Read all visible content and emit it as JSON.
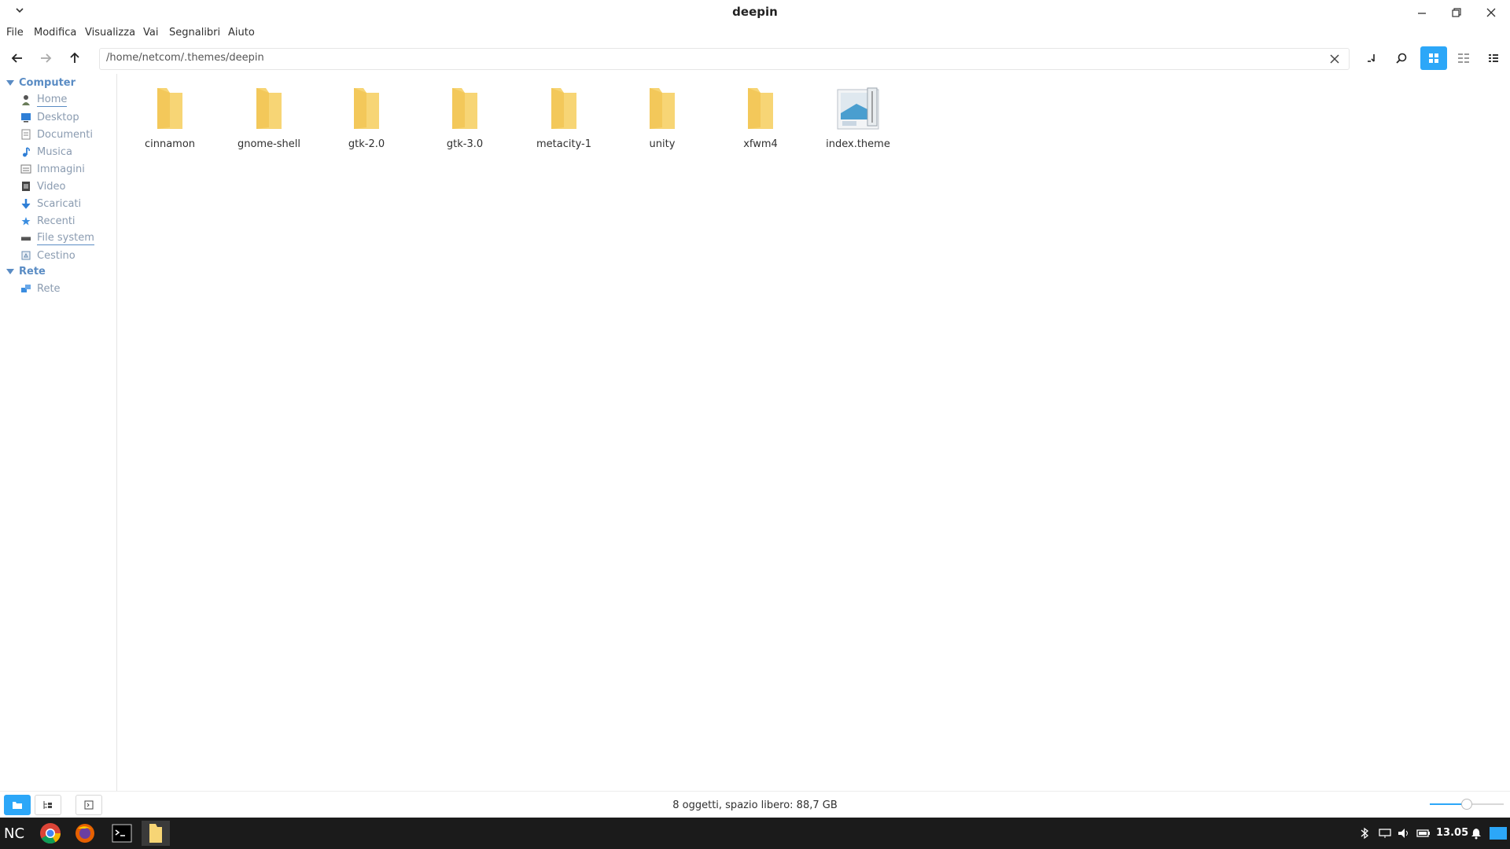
{
  "window": {
    "title": "deepin"
  },
  "menu": {
    "items": [
      "File",
      "Modifica",
      "Visualizza",
      "Vai",
      "Segnalibri",
      "Aiuto"
    ]
  },
  "toolbar": {
    "address": "/home/netcom/.themes/deepin",
    "icons": {
      "back": "arrow-left-icon",
      "forward": "arrow-right-icon",
      "up": "arrow-up-icon",
      "clear": "close-icon",
      "terminal": "terminal-icon",
      "search": "search-icon",
      "icon_view": "icon-view-icon",
      "compact_view": "compact-view-icon",
      "list_view": "list-view-icon"
    }
  },
  "sidebar": {
    "sections": [
      {
        "title": "Computer",
        "items": [
          "Home",
          "Desktop",
          "Documenti",
          "Musica",
          "Immagini",
          "Video",
          "Scaricati",
          "Recenti",
          "File system",
          "Cestino"
        ]
      },
      {
        "title": "Rete",
        "items": [
          "Rete"
        ]
      }
    ]
  },
  "files": [
    {
      "name": "cinnamon",
      "type": "folder"
    },
    {
      "name": "gnome-shell",
      "type": "folder"
    },
    {
      "name": "gtk-2.0",
      "type": "folder"
    },
    {
      "name": "gtk-3.0",
      "type": "folder"
    },
    {
      "name": "metacity-1",
      "type": "folder"
    },
    {
      "name": "unity",
      "type": "folder"
    },
    {
      "name": "xfwm4",
      "type": "folder"
    },
    {
      "name": "index.theme",
      "type": "file"
    }
  ],
  "status": {
    "text": "8 oggetti, spazio libero: 88,7 GB",
    "zoom_fraction": 0.5
  },
  "taskbar": {
    "clock": "13.05",
    "apps": [
      "nc-logo",
      "chrome-icon",
      "firefox-icon",
      "terminal-icon",
      "file-manager-icon"
    ]
  },
  "colors": {
    "accent": "#2ca7f8",
    "folder": "#f7d575",
    "sidebar_text": "#8a9bb0",
    "taskbar": "#1b1b1b"
  }
}
